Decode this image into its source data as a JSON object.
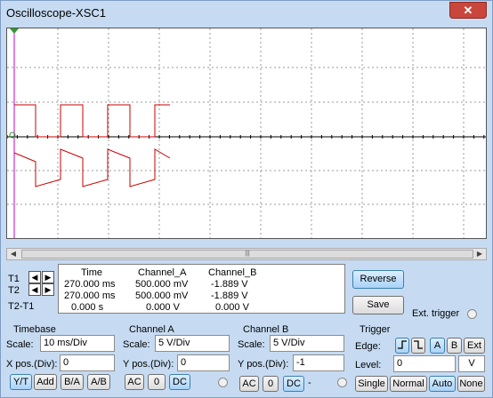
{
  "window": {
    "title": "Oscilloscope-XSC1",
    "close_label": "✕"
  },
  "cursors": {
    "t1": "T1",
    "t2": "T2",
    "t2_t1": "T2-T1",
    "headers": {
      "time": "Time",
      "channel_a": "Channel_A",
      "channel_b": "Channel_B"
    },
    "rows": [
      {
        "time": "270.000 ms",
        "a": "500.000 mV",
        "b": "-1.889 V"
      },
      {
        "time": "270.000 ms",
        "a": "500.000 mV",
        "b": "-1.889 V"
      },
      {
        "time": "0.000 s",
        "a": "0.000 V",
        "b": "0.000 V"
      }
    ]
  },
  "buttons": {
    "reverse": "Reverse",
    "save": "Save",
    "ext_trigger": "Ext. trigger"
  },
  "timebase": {
    "title": "Timebase",
    "scale_label": "Scale:",
    "scale_value": "10 ms/Div",
    "xpos_label": "X pos.(Div):",
    "xpos_value": "0",
    "modes": [
      "Y/T",
      "Add",
      "B/A",
      "A/B"
    ],
    "active_mode": "Y/T"
  },
  "channel_a": {
    "title": "Channel A",
    "scale_label": "Scale:",
    "scale_value": "5  V/Div",
    "ypos_label": "Y pos.(Div):",
    "ypos_value": "0",
    "coupling": [
      "AC",
      "0",
      "DC"
    ],
    "active_coupling": "DC"
  },
  "channel_b": {
    "title": "Channel B",
    "scale_label": "Scale:",
    "scale_value": "5  V/Div",
    "ypos_label": "Y pos.(Div):",
    "ypos_value": "-1",
    "coupling": [
      "AC",
      "0",
      "DC"
    ],
    "active_coupling": "DC",
    "coupling_suffix": "-"
  },
  "trigger": {
    "title": "Trigger",
    "edge_label": "Edge:",
    "level_label": "Level:",
    "level_value": "0",
    "level_unit": "V",
    "edge_buttons": [
      "A",
      "B",
      "Ext"
    ],
    "active_edge_source": "A",
    "modes": [
      "Single",
      "Normal",
      "Auto",
      "None"
    ],
    "active_mode": "Auto"
  },
  "scrollbar": {
    "left": "◀",
    "right": "▶",
    "grip": "|||"
  },
  "colors": {
    "channel_a": "#cc0000",
    "channel_b": "#000000",
    "cursor_t1": "#cc00cc"
  }
}
